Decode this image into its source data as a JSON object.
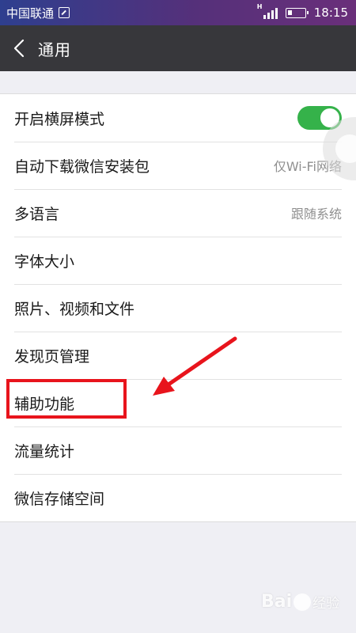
{
  "status_bar": {
    "carrier": "中国联通",
    "time": "18:15",
    "network_type": "H",
    "icons": [
      "sim-icon",
      "signal-icon",
      "battery-icon"
    ]
  },
  "header": {
    "back_icon": "chevron-left-icon",
    "title": "通用"
  },
  "settings": {
    "items": [
      {
        "label": "开启横屏模式",
        "toggle": true
      },
      {
        "label": "自动下载微信安装包",
        "value": "仅Wi-Fi网络"
      },
      {
        "label": "多语言",
        "value": "跟随系统"
      },
      {
        "label": "字体大小"
      },
      {
        "label": "照片、视频和文件"
      },
      {
        "label": "发现页管理"
      },
      {
        "label": "辅助功能"
      },
      {
        "label": "流量统计"
      },
      {
        "label": "微信存储空间"
      }
    ]
  },
  "colors": {
    "status_bar_start": "#2e3f8f",
    "status_bar_end": "#6a2f7a",
    "title_bar": "#37373b",
    "toggle_on": "#35b24a",
    "annotation_red": "#e8141c",
    "background": "#efeff4"
  },
  "watermark": {
    "text": "Bai",
    "sub": "经验"
  }
}
